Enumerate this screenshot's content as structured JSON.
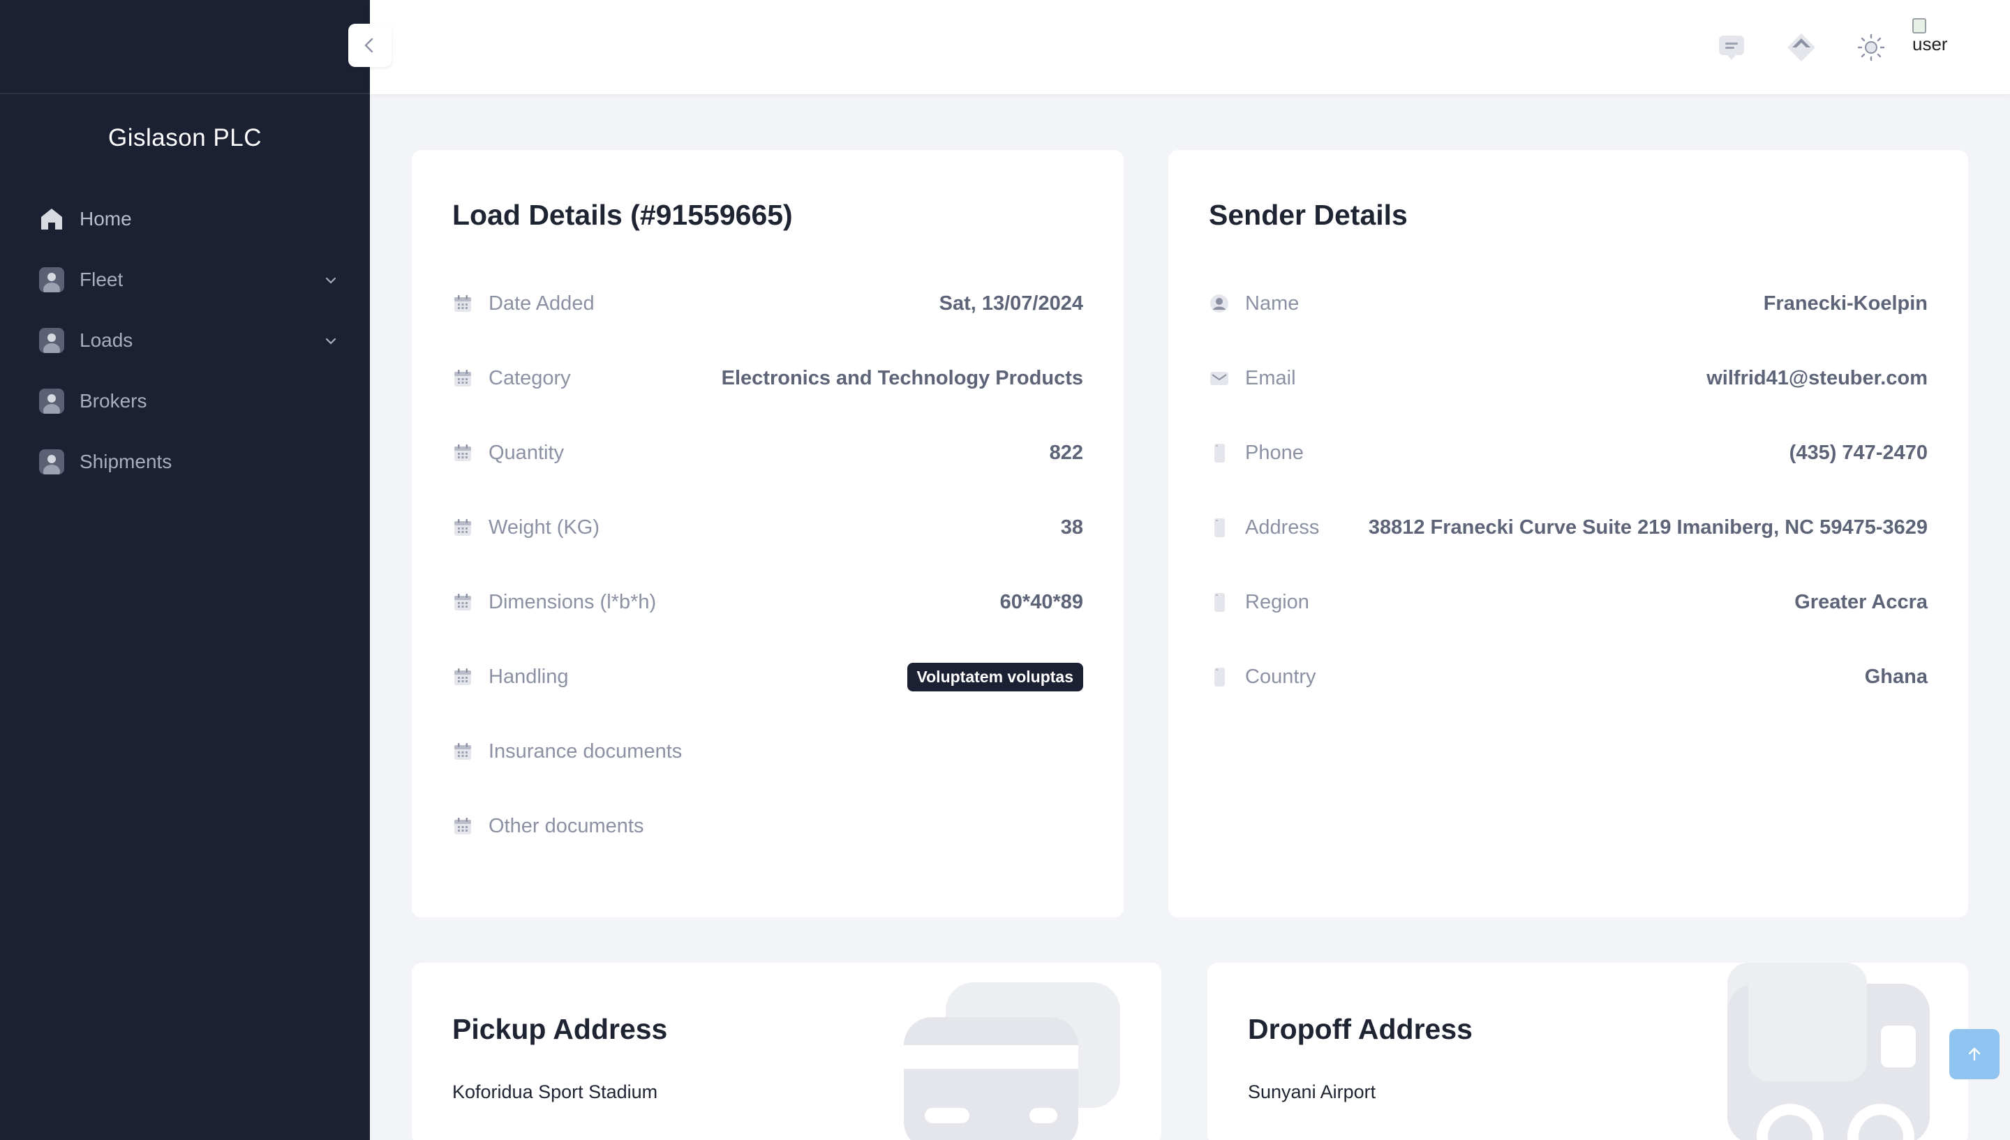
{
  "sidebar": {
    "brand": "Gislason PLC",
    "items": [
      {
        "label": "Home",
        "icon": "home-icon",
        "has_chevron": false
      },
      {
        "label": "Fleet",
        "icon": "avatar-icon",
        "has_chevron": true
      },
      {
        "label": "Loads",
        "icon": "avatar-icon",
        "has_chevron": true
      },
      {
        "label": "Brokers",
        "icon": "avatar-icon",
        "has_chevron": false
      },
      {
        "label": "Shipments",
        "icon": "avatar-icon",
        "has_chevron": false
      }
    ]
  },
  "topbar": {
    "icons": [
      "chat-icon",
      "send-icon",
      "sun-icon"
    ],
    "user_img_alt": "user"
  },
  "load_details": {
    "title": "Load Details (#91559665)",
    "rows": [
      {
        "label": "Date Added",
        "value": "Sat, 13/07/2024",
        "icon": "calendar-icon"
      },
      {
        "label": "Category",
        "value": "Electronics and Technology Products",
        "icon": "calendar-icon"
      },
      {
        "label": "Quantity",
        "value": "822",
        "icon": "calendar-icon"
      },
      {
        "label": "Weight (KG)",
        "value": "38",
        "icon": "calendar-icon"
      },
      {
        "label": "Dimensions (l*b*h)",
        "value": "60*40*89",
        "icon": "calendar-icon"
      },
      {
        "label": "Handling",
        "badge": "Voluptatem voluptas",
        "icon": "calendar-icon"
      },
      {
        "label": "Insurance documents",
        "value": "",
        "icon": "calendar-icon"
      },
      {
        "label": "Other documents",
        "value": "",
        "icon": "calendar-icon"
      }
    ]
  },
  "sender_details": {
    "title": "Sender Details",
    "rows": [
      {
        "label": "Name",
        "value": "Franecki-Koelpin",
        "icon": "user-icon"
      },
      {
        "label": "Email",
        "value": "wilfrid41@steuber.com",
        "icon": "mail-icon"
      },
      {
        "label": "Phone",
        "value": "(435) 747-2470",
        "icon": "phone-icon"
      },
      {
        "label": "Address",
        "value": "38812 Franecki Curve Suite 219 Imaniberg, NC 59475-3629",
        "icon": "phone-icon"
      },
      {
        "label": "Region",
        "value": "Greater Accra",
        "icon": "phone-icon"
      },
      {
        "label": "Country",
        "value": "Ghana",
        "icon": "phone-icon"
      }
    ]
  },
  "pickup": {
    "title": "Pickup Address",
    "address": "Koforidua Sport Stadium"
  },
  "dropoff": {
    "title": "Dropoff Address",
    "address": "Sunyani Airport"
  },
  "colors": {
    "sidebar_bg": "#1c2033",
    "page_bg": "#f3f4f7",
    "badge_bg": "#1c2033",
    "scroll_top_bg": "#8fc3f0"
  }
}
